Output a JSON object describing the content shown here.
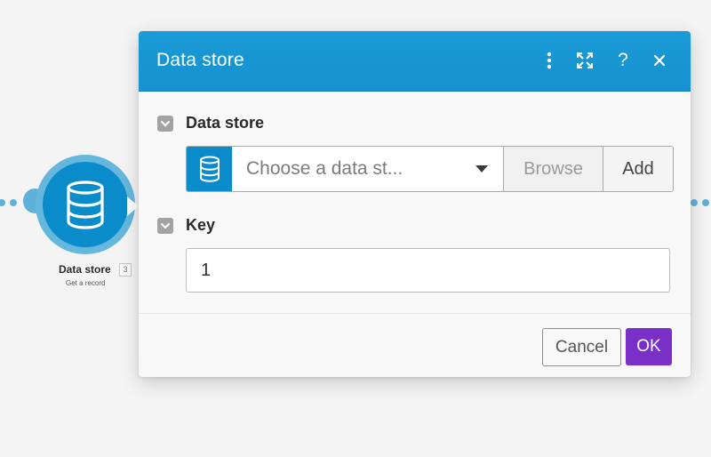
{
  "colors": {
    "accent": "#0a8ccb",
    "header": "#1592cf",
    "ok_button": "#7a30c8"
  },
  "module_node": {
    "title": "Data store",
    "badge": "3",
    "subtitle": "Get a record",
    "icon": "database-icon"
  },
  "dialog": {
    "title": "Data store",
    "header_buttons": {
      "more": "more-vertical-icon",
      "expand": "expand-icon",
      "help": "?",
      "close": "close-icon"
    },
    "data_store_section": {
      "label": "Data store",
      "select_placeholder": "Choose a data st...",
      "browse_label": "Browse",
      "add_label": "Add"
    },
    "key_section": {
      "label": "Key",
      "value": "1"
    },
    "footer": {
      "cancel_label": "Cancel",
      "ok_label": "OK"
    }
  }
}
